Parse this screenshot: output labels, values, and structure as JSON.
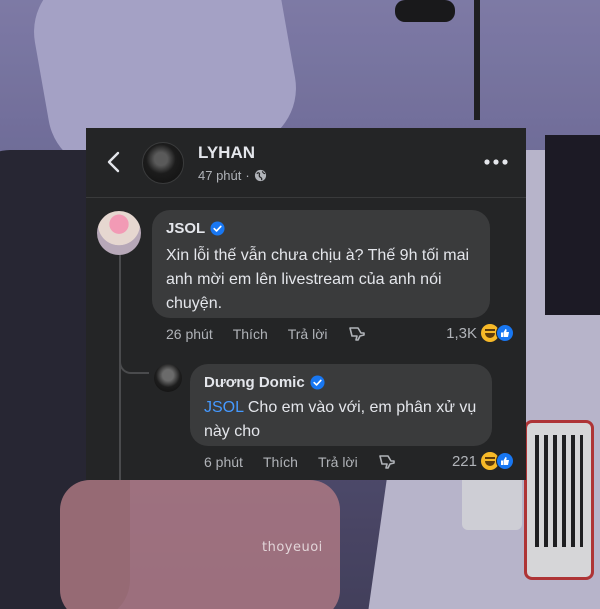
{
  "post": {
    "author": "LYHAN",
    "time": "47 phút",
    "separator": "·"
  },
  "comments": [
    {
      "author": "JSOL",
      "verified": true,
      "text": "Xin lỗi thế vẫn chưa chịu à? Thế 9h tối mai anh mời em lên livestream của anh nói chuyện.",
      "time": "26 phút",
      "like_label": "Thích",
      "reply_label": "Trả lời",
      "reaction_count": "1,3K",
      "reactions": [
        "haha-icon",
        "like-icon"
      ]
    },
    {
      "author": "Dương Domic",
      "verified": true,
      "mention": "JSOL",
      "text": "Cho em vào với, em phân xử vụ này cho",
      "time": "6 phút",
      "like_label": "Thích",
      "reply_label": "Trả lời",
      "reaction_count": "221",
      "reactions": [
        "haha-icon",
        "like-icon"
      ]
    }
  ],
  "watermark": "thoyeuoi",
  "colors": {
    "panel_bg": "#242526",
    "bubble_bg": "#3a3b3c",
    "text": "#e4e6eb",
    "muted": "#b0b3b8",
    "mention": "#4599ff",
    "verified": "#1877f2",
    "haha": "#f7b928"
  }
}
